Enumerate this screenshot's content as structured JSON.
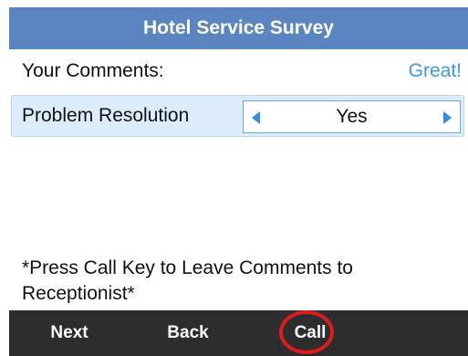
{
  "header": {
    "title": "Hotel Service Survey"
  },
  "comments": {
    "label": "Your Comments:",
    "value": "Great!"
  },
  "selector": {
    "label": "Problem Resolution",
    "value": "Yes"
  },
  "hint": {
    "text": "*Press Call Key to Leave Comments to Receptionist*"
  },
  "softkeys": {
    "next": "Next",
    "back": "Back",
    "call": "Call"
  },
  "icons": {
    "prev": "chevron-left-icon",
    "next": "chevron-right-icon"
  },
  "colors": {
    "title_bar": "#5b85c0",
    "accent_text": "#3a9ae6",
    "selected_row": "#dcecfb",
    "softkey_bar": "#2d2d2f",
    "call_highlight": "#e01b1b"
  }
}
